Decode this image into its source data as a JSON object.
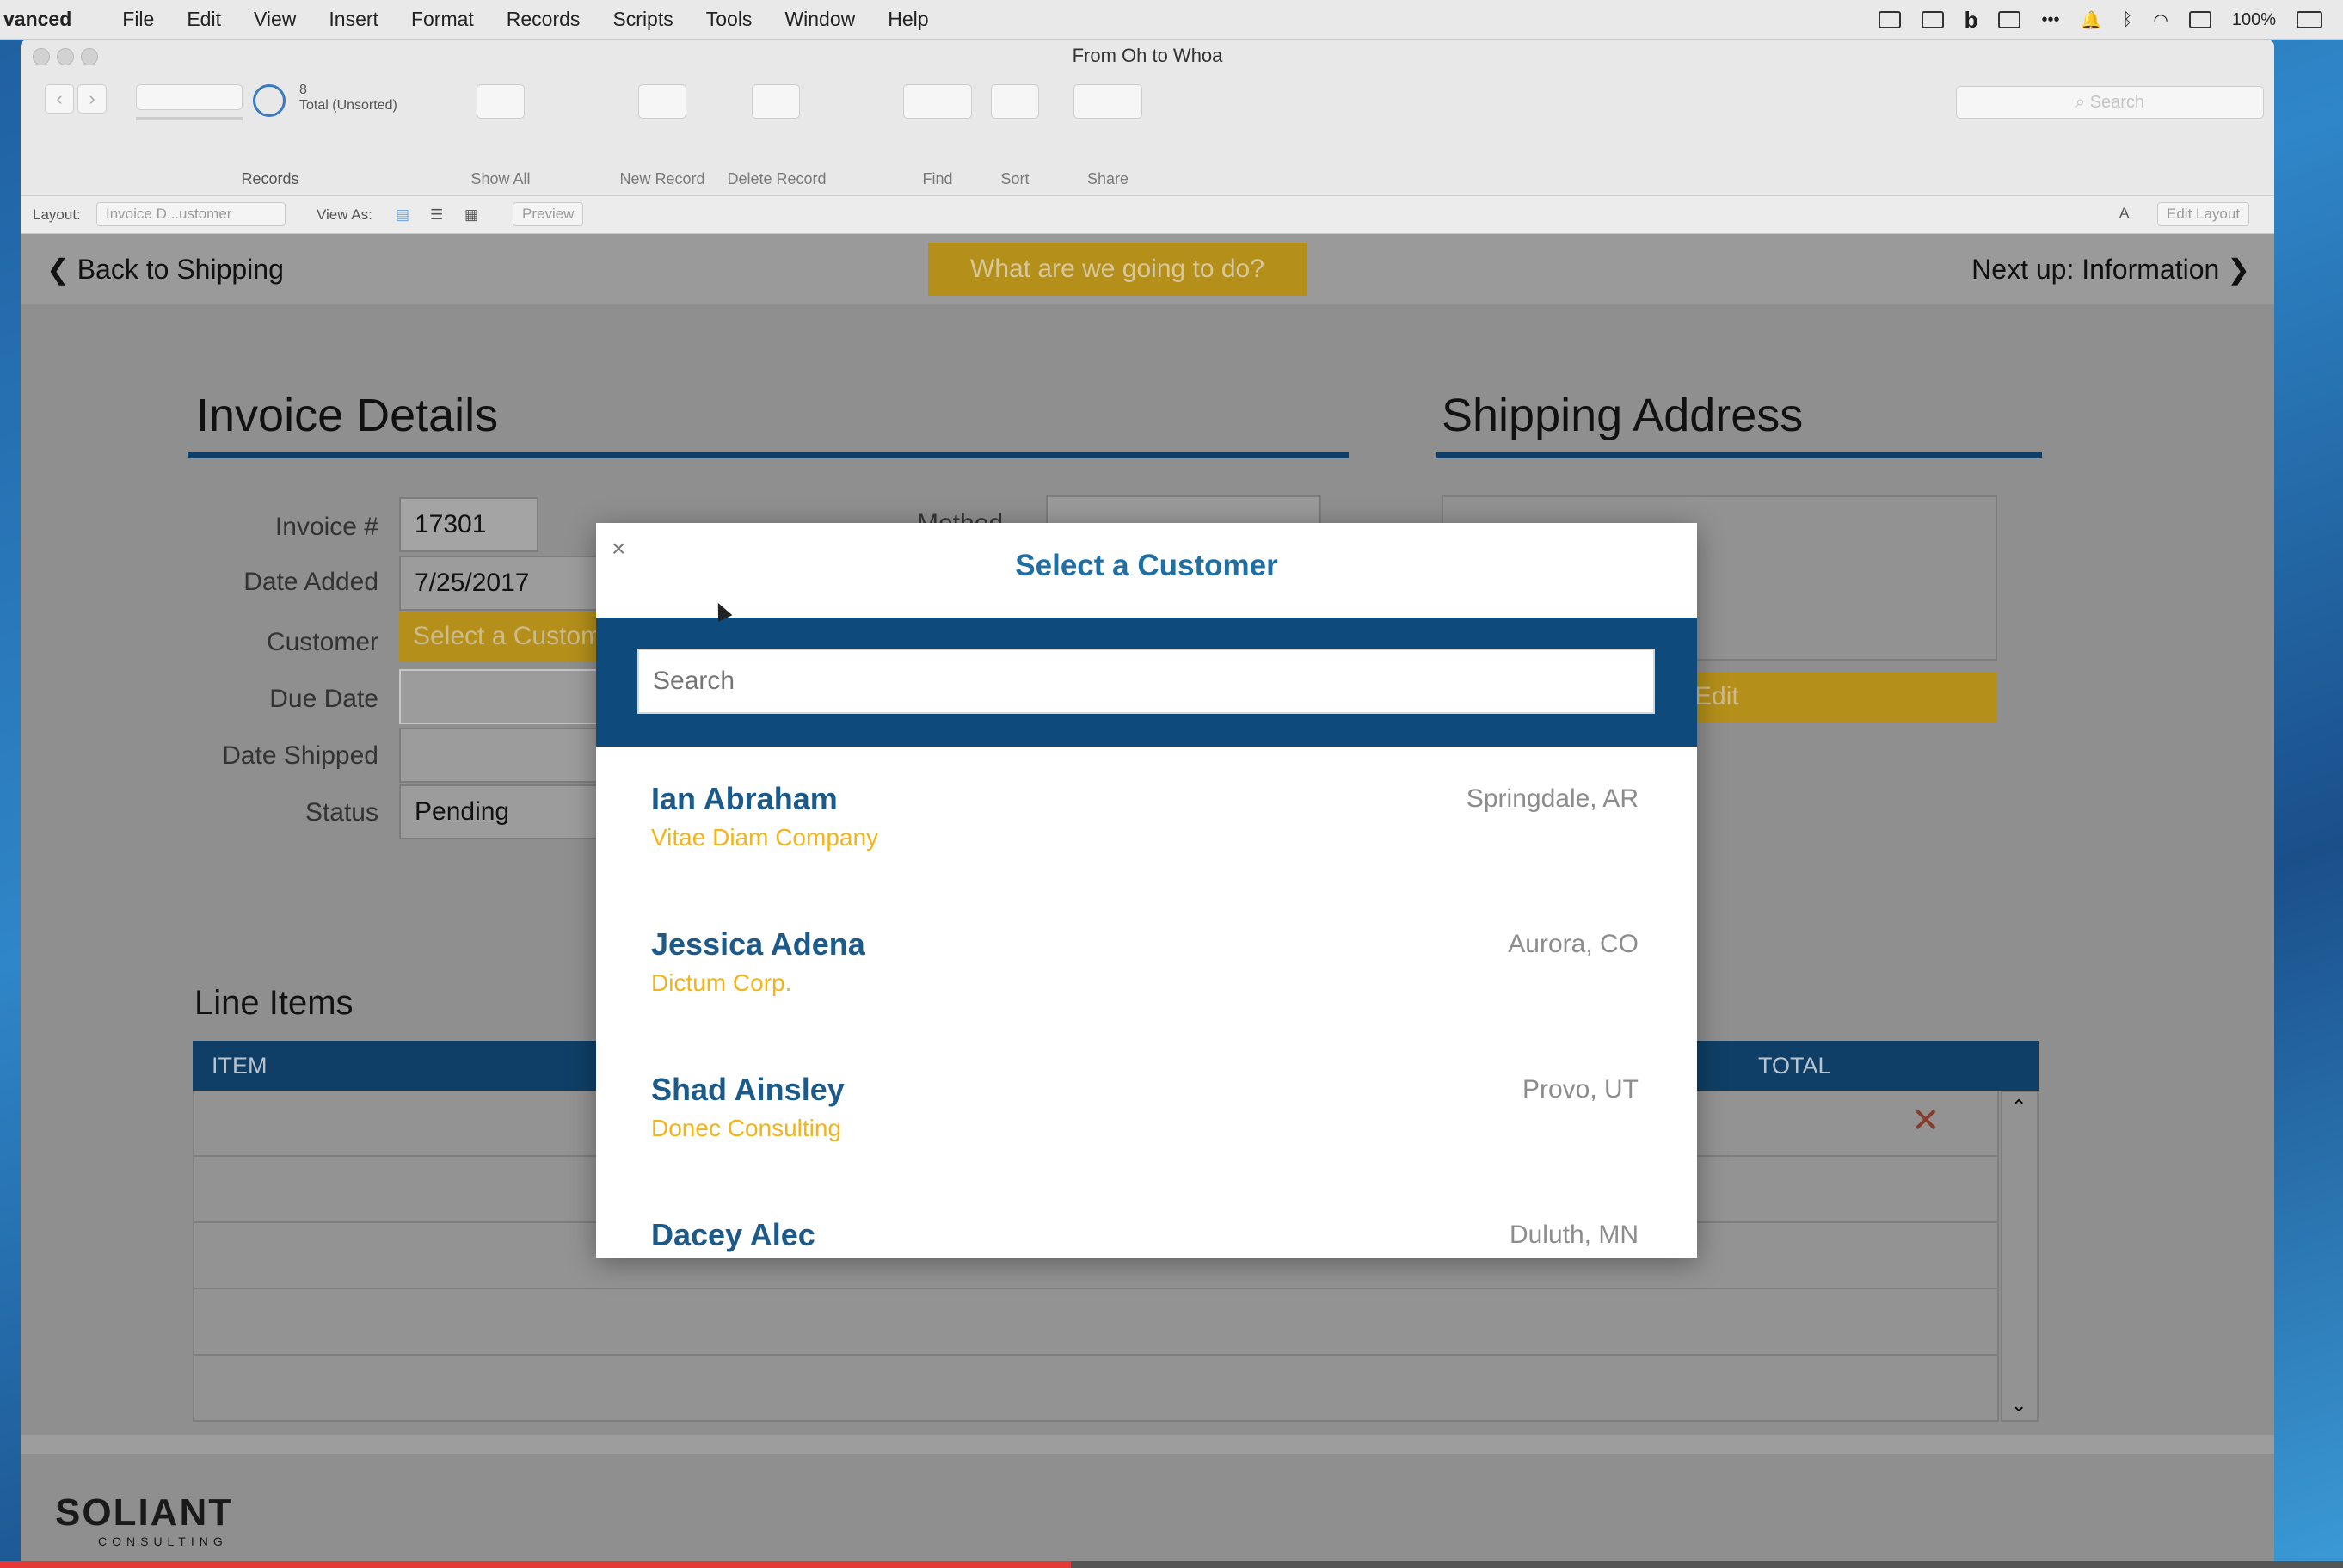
{
  "menubar": {
    "app": "vanced",
    "items": [
      "File",
      "Edit",
      "View",
      "Insert",
      "Format",
      "Records",
      "Scripts",
      "Tools",
      "Window",
      "Help"
    ],
    "battery": "100%"
  },
  "window": {
    "title": "From Oh to Whoa"
  },
  "toolbar": {
    "record_number": "8",
    "record_total": "Total (Unsorted)",
    "records_label": "Records",
    "show_all": "Show All",
    "new_record": "New Record",
    "delete_record": "Delete Record",
    "find": "Find",
    "sort": "Sort",
    "share": "Share",
    "search_placeholder": "Search"
  },
  "layoutbar": {
    "layout_label": "Layout:",
    "layout_value": "Invoice D...ustomer",
    "view_as": "View As:",
    "preview": "Preview",
    "edit_layout": "Edit Layout"
  },
  "nav": {
    "back": "Back to Shipping",
    "center_button": "What are we going to do?",
    "next": "Next up: Information"
  },
  "invoice": {
    "title": "Invoice Details",
    "fields": {
      "invoice_label": "Invoice #",
      "invoice_value": "17301",
      "date_added_label": "Date Added",
      "date_added_value": "7/25/2017",
      "customer_label": "Customer",
      "customer_value": "Select a Custom",
      "due_date_label": "Due Date",
      "date_shipped_label": "Date Shipped",
      "status_label": "Status",
      "status_value": "Pending",
      "method_label": "Method"
    }
  },
  "shipping": {
    "title": "Shipping Address",
    "edit": "Edit"
  },
  "line_items": {
    "title": "Line Items",
    "col_item": "ITEM",
    "col_total": "TOTAL"
  },
  "modal": {
    "title": "Select a Customer",
    "close": "×",
    "search_placeholder": "Search",
    "customers": [
      {
        "name": "Ian Abraham",
        "company": "Vitae Diam Company",
        "location": "Springdale, AR"
      },
      {
        "name": "Jessica Adena",
        "company": "Dictum Corp.",
        "location": "Aurora, CO"
      },
      {
        "name": "Shad Ainsley",
        "company": "Donec Consulting",
        "location": "Provo, UT"
      },
      {
        "name": "Dacey Alec",
        "company": "",
        "location": "Duluth, MN"
      }
    ]
  },
  "logo": {
    "name": "SOLIANT",
    "sub": "CONSULTING"
  },
  "video": {
    "progress": 0.457
  },
  "colors": {
    "accent_blue": "#0f4a7c",
    "accent_yellow": "#f2b418",
    "title_blue": "#1f6fa5",
    "progress_red": "#e53935"
  }
}
